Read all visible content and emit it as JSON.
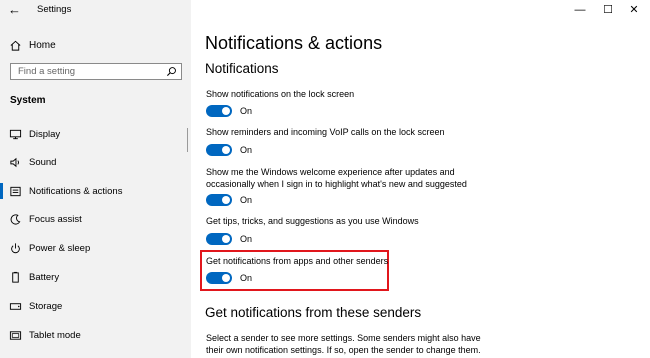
{
  "window": {
    "title": "Settings",
    "back_glyph": "←",
    "minimize_glyph": "—",
    "maximize_glyph": "☐",
    "close_glyph": "✕"
  },
  "sidebar": {
    "home_label": "Home",
    "search_placeholder": "Find a setting",
    "section_label": "System",
    "items": [
      {
        "label": "Display",
        "icon": "display-icon"
      },
      {
        "label": "Sound",
        "icon": "sound-icon"
      },
      {
        "label": "Notifications & actions",
        "icon": "notifications-icon",
        "active": true
      },
      {
        "label": "Focus assist",
        "icon": "moon-icon"
      },
      {
        "label": "Power & sleep",
        "icon": "power-icon"
      },
      {
        "label": "Battery",
        "icon": "battery-icon"
      },
      {
        "label": "Storage",
        "icon": "storage-icon"
      },
      {
        "label": "Tablet mode",
        "icon": "tablet-icon"
      }
    ]
  },
  "main": {
    "title": "Notifications & actions",
    "subtitle": "Notifications",
    "settings": [
      {
        "label": "Show notifications on the lock screen",
        "state": "On"
      },
      {
        "label": "Show reminders and incoming VoIP calls on the lock screen",
        "state": "On"
      },
      {
        "label_line1": "Show me the Windows welcome experience after updates and",
        "label_line2": "occasionally when I sign in to highlight what's new and suggested",
        "state": "On"
      },
      {
        "label": "Get tips, tricks, and suggestions as you use Windows",
        "state": "On"
      },
      {
        "label": "Get notifications from apps and other senders",
        "state": "On",
        "highlighted": true
      }
    ],
    "senders_title": "Get notifications from these senders",
    "senders_desc_line1": "Select a sender to see more settings. Some senders might also have",
    "senders_desc_line2": "their own notification settings. If so, open the sender to change them."
  },
  "colors": {
    "accent": "#0067c0",
    "highlight": "#e1161c",
    "sidebar_bg": "#f2f2f2"
  }
}
